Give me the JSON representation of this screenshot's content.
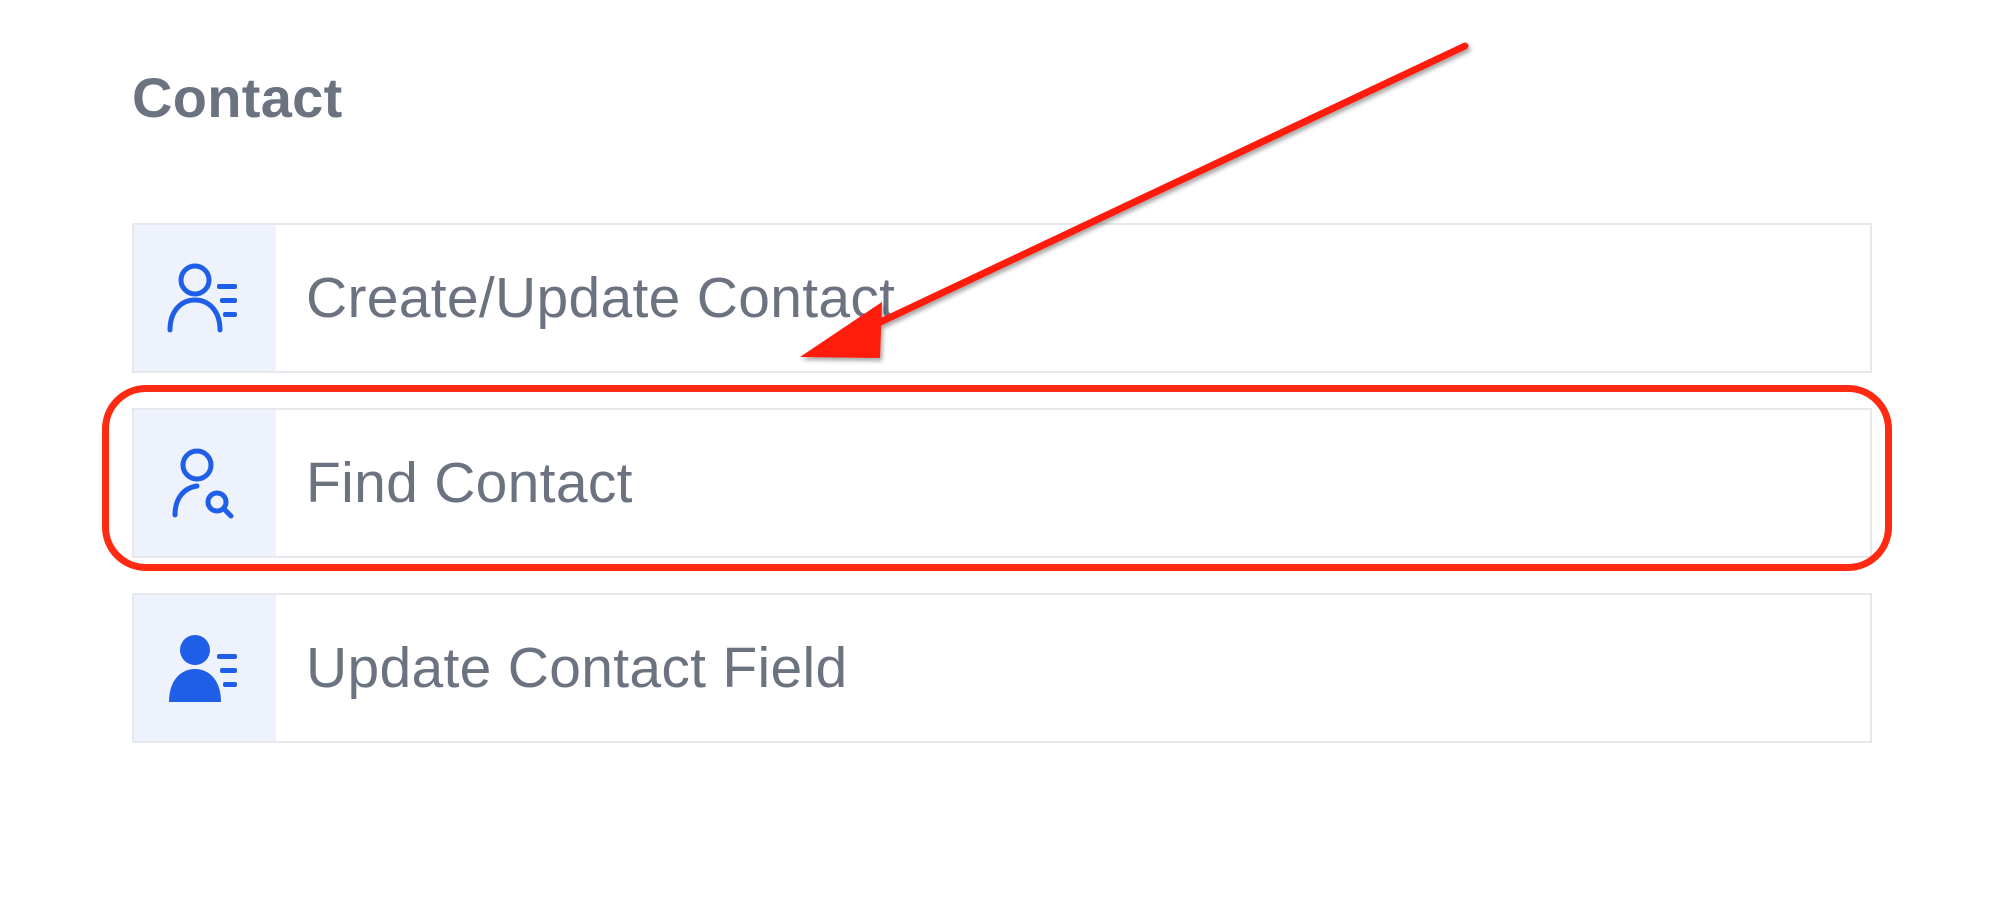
{
  "section": {
    "title": "Contact"
  },
  "actions": [
    {
      "label": "Create/Update Contact",
      "icon": "contact-list-outline-icon"
    },
    {
      "label": "Find Contact",
      "icon": "contact-search-icon"
    },
    {
      "label": "Update Contact Field",
      "icon": "contact-list-solid-icon"
    }
  ],
  "annotations": {
    "highlight_target": "Find Contact",
    "arrow_color": "#ff1a0a",
    "ring_color": "#ff2a12"
  },
  "colors": {
    "icon_accent": "#1f5fe8",
    "icon_background": "#eef2fd",
    "text": "#6b7280",
    "border": "#e6e8ec"
  }
}
